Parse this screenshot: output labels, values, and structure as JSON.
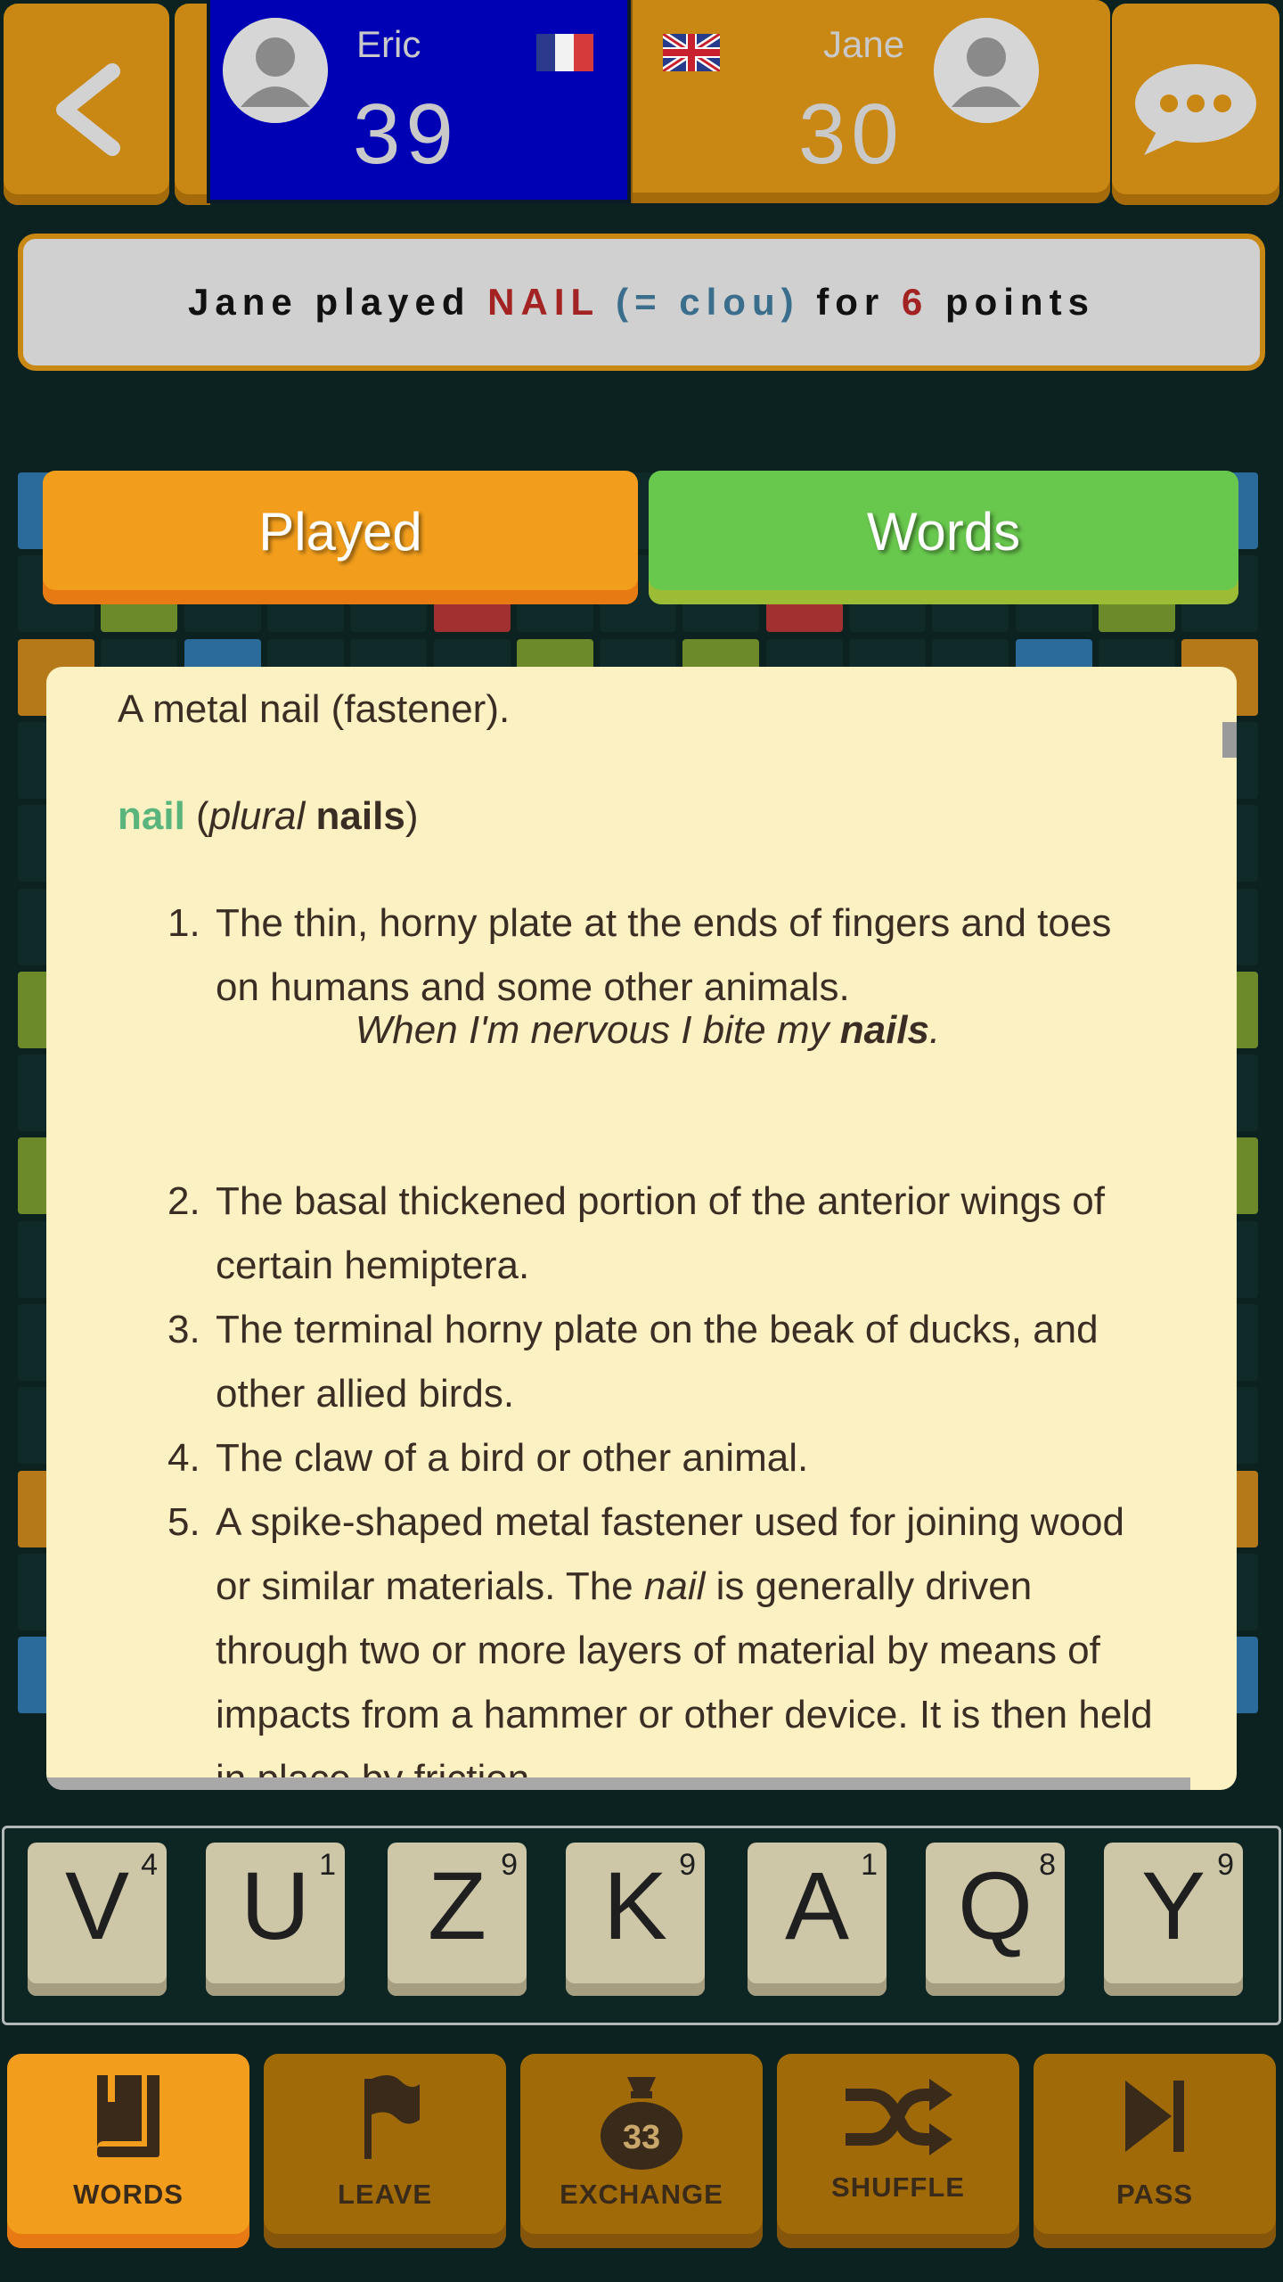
{
  "colors": {
    "background": "#0b2221",
    "accent_orange": "#f29e1c",
    "accent_green": "#68c74d",
    "player_me_bg": "#0000b4",
    "panel_bg": "#fcf1c3",
    "headword_green": "#5ab57c",
    "word_red": "#a32222",
    "word_blue": "#3b6e8c"
  },
  "header": {
    "back_icon": "chevron-left-icon",
    "chat_icon": "speech-bubble-icon",
    "player_me": {
      "name": "Eric",
      "score": "39",
      "flag": "france-flag"
    },
    "player_opponent": {
      "name": "Jane",
      "score": "30",
      "flag": "uk-flag"
    }
  },
  "banner": {
    "prefix": "Jane played ",
    "word": "NAIL",
    "translation": "(= clou)",
    "middle": " for ",
    "points": "6",
    "suffix": " points"
  },
  "tabs": [
    {
      "label": "Played",
      "active": true
    },
    {
      "label": "Words",
      "active": false
    }
  ],
  "definition": {
    "intro": "A metal nail (fastener).",
    "headword": "nail",
    "open_paren": "(",
    "plural_word": "plural",
    "plural_form": "nails",
    "close_paren": ")",
    "senses": [
      {
        "num": "1.",
        "text": "The thin, horny plate at the ends of fingers and toes on humans and some other animals."
      },
      {
        "num": "2.",
        "text": "The basal thickened portion of the anterior wings of certain hemiptera."
      },
      {
        "num": "3.",
        "text": "The terminal horny plate on the beak of ducks, and other allied birds."
      },
      {
        "num": "4.",
        "text": "The claw of a bird or other animal."
      },
      {
        "num": "5.",
        "text_before": "A spike-shaped metal fastener used for joining wood or similar materials. The ",
        "text_italic": "nail",
        "text_after": " is generally driven through two or more layers of material by means of impacts from a hammer or other device. It is then held in place by friction."
      }
    ],
    "example": {
      "before": "When I'm nervous I bite my ",
      "bold": "nails",
      "after": "."
    }
  },
  "rack": [
    {
      "letter": "V",
      "points": "4"
    },
    {
      "letter": "U",
      "points": "1"
    },
    {
      "letter": "Z",
      "points": "9"
    },
    {
      "letter": "K",
      "points": "9"
    },
    {
      "letter": "A",
      "points": "1"
    },
    {
      "letter": "Q",
      "points": "8"
    },
    {
      "letter": "Y",
      "points": "9"
    }
  ],
  "toolbar": [
    {
      "label": "WORDS",
      "icon": "book-icon",
      "active": true
    },
    {
      "label": "LEAVE",
      "icon": "flag-icon",
      "active": false
    },
    {
      "label": "EXCHANGE",
      "icon": "bag-icon",
      "bag_count": "33",
      "active": false
    },
    {
      "label": "SHUFFLE",
      "icon": "shuffle-icon",
      "active": false
    },
    {
      "label": "PASS",
      "icon": "skip-icon",
      "active": false
    }
  ]
}
